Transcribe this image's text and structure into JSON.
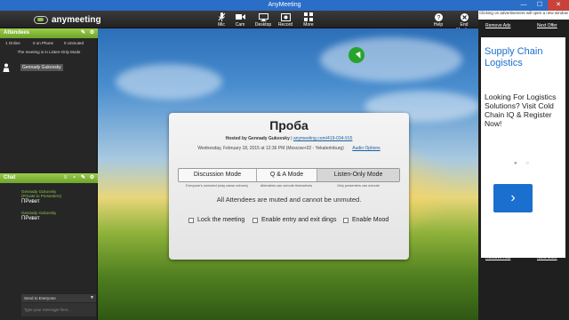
{
  "window": {
    "title": "AnyMeeting",
    "min": "—",
    "max": "☐",
    "close": "✕"
  },
  "toolbar": {
    "logo": "anymeeting",
    "buttons": [
      {
        "label": "Mic",
        "icon": "mic-icon"
      },
      {
        "label": "Cam",
        "icon": "camera-icon"
      },
      {
        "label": "Desktop",
        "icon": "desktop-icon"
      },
      {
        "label": "Record",
        "icon": "record-icon"
      },
      {
        "label": "More",
        "icon": "more-icon"
      },
      {
        "label": "Help",
        "icon": "help-icon"
      },
      {
        "label": "End Meeting",
        "icon": "end-meeting-icon"
      }
    ]
  },
  "ad": {
    "note": "Clicking on advertisement will open a new window",
    "remove_ads": "Remove Ads",
    "next_offer": "Next Offer",
    "title": "Supply Chain Logistics",
    "body": "Looking For Logistics Solutions? Visit Cold Chain IQ & Register Now!",
    "dots": "● ○",
    "arrow": "›"
  },
  "attendees": {
    "header": "Attendees",
    "online": "1 Online",
    "on_phone": "0 on Phone",
    "unmuted": "0 Unmuted",
    "mode_note": "The meeting is in Listen-Only Mode",
    "list": [
      "Gennady Gukovsky"
    ]
  },
  "chat": {
    "header": "Chat",
    "messages": [
      {
        "who": "Gennady Gukovsky",
        "sub": "(Private to Presenters)",
        "text": "ПРивет"
      },
      {
        "who": "Gennady Gukovsky",
        "sub": "",
        "text": "ПРивет"
      }
    ],
    "send_to": "Send to Everyone",
    "placeholder": "Type your message here..."
  },
  "meeting": {
    "title": "Проба",
    "hosted_by_prefix": "Hosted by",
    "host": "Gennady Gukovsky",
    "separator": "|",
    "link": "anymeeting.com/419-034-915",
    "datetime": "Wednesday, February 18, 2015 at 12:36 PM (Moscow+02 - Yekaterinburg)",
    "audio_options": "Audio Options",
    "modes": [
      "Discussion Mode",
      "Q & A Mode",
      "Listen-Only Mode"
    ],
    "mode_descs": [
      "Everyone's unmuted (may cause echoes)",
      "Attendees can unmute themselves",
      "Only presenters can unmute"
    ],
    "status": "All Attendees are muted and cannot be unmuted.",
    "options": [
      "Lock the meeting",
      "Enable entry and exit dings",
      "Enable Mood"
    ]
  }
}
